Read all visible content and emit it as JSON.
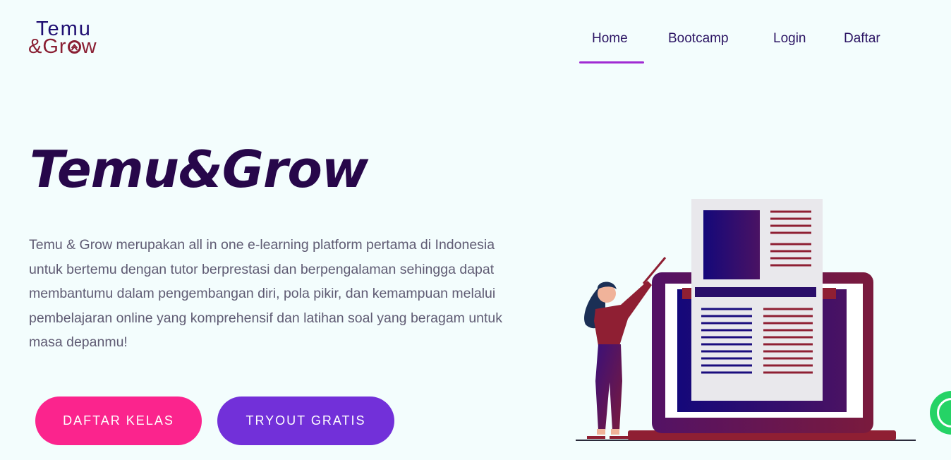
{
  "logo": {
    "line1": "Temu",
    "line2_prefix": "&Gr",
    "line2_suffix": "w"
  },
  "nav": {
    "items": [
      {
        "label": "Home",
        "active": true
      },
      {
        "label": "Bootcamp"
      },
      {
        "label": "Login"
      },
      {
        "label": "Daftar"
      }
    ]
  },
  "hero": {
    "title": "Temu&Grow",
    "description": "Temu & Grow merupakan all in one e-learning platform pertama di Indonesia untuk bertemu dengan tutor berprestasi dan berpengalaman sehingga dapat membantumu dalam pengembangan diri, pola pikir, dan kemampuan melalui pembelajaran online yang komprehensif dan latihan soal yang beragam untuk masa depanmu!",
    "buttons": {
      "primary": "DAFTAR KELAS",
      "secondary": "TRYOUT GRATIS"
    }
  },
  "colors": {
    "background": "#f3fdfd",
    "brand_navy": "#1f0e72",
    "brand_maroon": "#8a1f33",
    "title": "#27074a",
    "nav_active": "#a02bd3",
    "button_pink": "#fb248d",
    "button_purple": "#7230d9",
    "whatsapp": "#25d366"
  },
  "icons": {
    "floating_chat": "whatsapp-icon",
    "logo_mark": "arrow-up-icon"
  }
}
